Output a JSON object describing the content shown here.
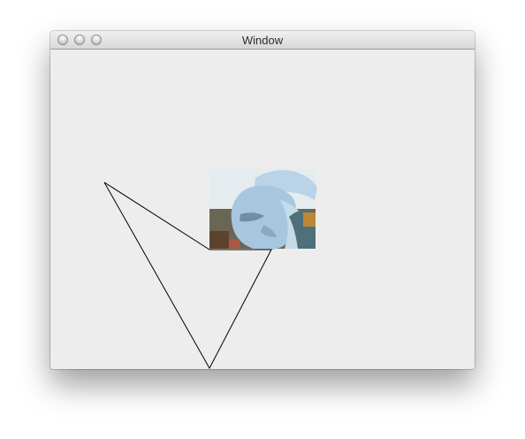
{
  "window": {
    "title": "Window"
  },
  "titlebar": {
    "buttons": [
      {
        "name": "close-button",
        "color": "#c9c9c9"
      },
      {
        "name": "minimize-button",
        "color": "#c9c9c9"
      },
      {
        "name": "zoom-button",
        "color": "#c9c9c9"
      }
    ]
  },
  "colors": {
    "window_background": "#ededed",
    "line_color": "#000000",
    "photo_sky": "#dfe7ec",
    "photo_face": "#9fbfd9",
    "photo_dark": "#5b5b4a"
  },
  "content": {
    "shape": "polyline",
    "image": "photo-of-statue"
  }
}
